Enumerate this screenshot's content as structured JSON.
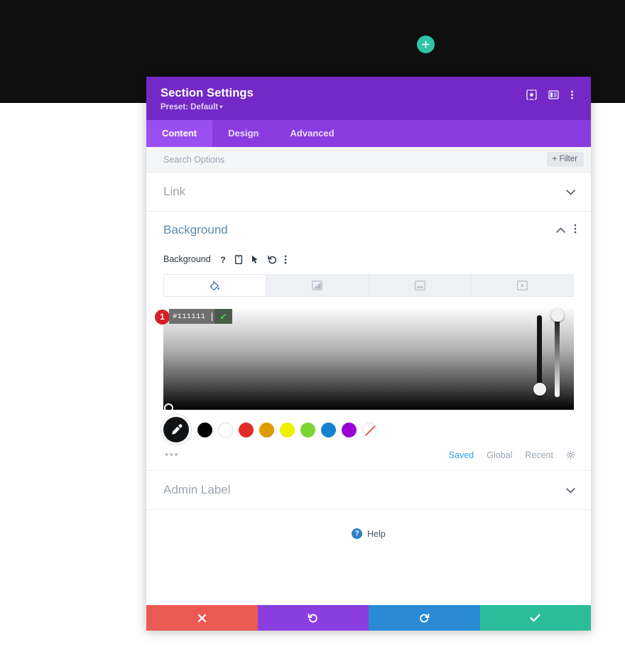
{
  "canvas": {
    "add_button_icon": "plus-icon",
    "accent_teal": "#2ec4a6",
    "top_band_color": "#0f0f0f"
  },
  "modal": {
    "title": "Section Settings",
    "preset_label": "Preset: Default",
    "preset_caret": "▾",
    "header_color": "#7429c6",
    "header_icons": [
      {
        "name": "focus-target-icon"
      },
      {
        "name": "layout-panel-icon"
      },
      {
        "name": "more-vertical-icon"
      }
    ],
    "tabs": [
      {
        "label": "Content",
        "active": true
      },
      {
        "label": "Design",
        "active": false
      },
      {
        "label": "Advanced",
        "active": false
      }
    ],
    "search": {
      "placeholder": "Search Options",
      "value": "",
      "filter_label": "+ Filter"
    },
    "rows": {
      "link": {
        "label": "Link",
        "chevron": "⌄"
      },
      "admin_label": {
        "label": "Admin Label",
        "chevron": "⌄"
      }
    },
    "background_section": {
      "title": "Background",
      "collapse_chevron": "⌃",
      "field_label": "Background",
      "field_icons": [
        {
          "name": "help-question-icon"
        },
        {
          "name": "mobile-device-icon"
        },
        {
          "name": "cursor-pointer-icon"
        },
        {
          "name": "reset-undo-icon"
        },
        {
          "name": "more-vertical-icon"
        }
      ],
      "type_tabs": [
        {
          "name": "background-color-tab",
          "icon": "paint-bucket-icon",
          "active": true
        },
        {
          "name": "background-gradient-tab",
          "icon": "gradient-icon",
          "active": false
        },
        {
          "name": "background-image-tab",
          "icon": "image-icon",
          "active": false
        },
        {
          "name": "background-video-tab",
          "icon": "video-icon",
          "active": false
        }
      ],
      "picker": {
        "hex_value": "#111111",
        "confirm_icon": "check-icon",
        "step_badge": "1",
        "hue_slider_name": "hue-slider",
        "alpha_slider_name": "alpha-slider"
      },
      "swatches": [
        {
          "name": "swatch-black",
          "color": "#000000"
        },
        {
          "name": "swatch-white",
          "color": "#ffffff"
        },
        {
          "name": "swatch-red",
          "color": "#e02b27"
        },
        {
          "name": "swatch-orange",
          "color": "#e09900"
        },
        {
          "name": "swatch-yellow",
          "color": "#edf000"
        },
        {
          "name": "swatch-green",
          "color": "#7cd334"
        },
        {
          "name": "swatch-blue",
          "color": "#1681d0"
        },
        {
          "name": "swatch-purple",
          "color": "#9b00d9"
        },
        {
          "name": "swatch-transparent",
          "color": "transparent"
        }
      ],
      "eyedropper_icon": "eyedropper-icon",
      "more_dots": "•••",
      "palette_tabs": [
        {
          "label": "Saved",
          "active": true
        },
        {
          "label": "Global",
          "active": false
        },
        {
          "label": "Recent",
          "active": false
        }
      ],
      "settings_icon": "gear-icon"
    },
    "help": {
      "label": "Help",
      "icon": "help-question-icon",
      "color": "#2a7fc9"
    },
    "footer_buttons": [
      {
        "name": "cancel-button",
        "icon": "close-x-icon",
        "color": "#ea5a52"
      },
      {
        "name": "undo-button",
        "icon": "undo-icon",
        "color": "#8b3ee0"
      },
      {
        "name": "redo-button",
        "icon": "redo-icon",
        "color": "#2a8ad4"
      },
      {
        "name": "save-button",
        "icon": "check-icon",
        "color": "#2bbd9a"
      }
    ]
  }
}
